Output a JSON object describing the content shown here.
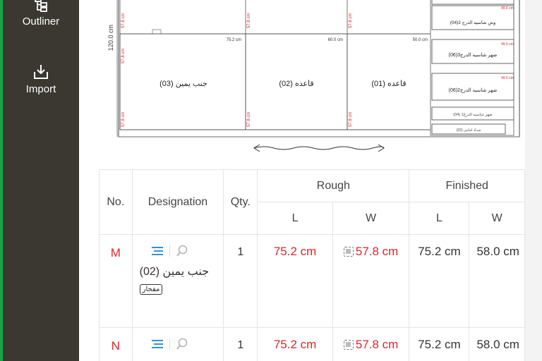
{
  "sidebar": {
    "items": [
      {
        "label": "Outliner",
        "icon": "outliner-icon"
      },
      {
        "label": "Import",
        "icon": "import-icon"
      }
    ]
  },
  "drawing": {
    "height_label": "120.0 cm",
    "widths": [
      "75.2 cm",
      "60.0 cm",
      "50.0 cm"
    ],
    "panels": [
      "جنب يمين (03)",
      "قاعده (02)",
      "قاعده (01)"
    ],
    "panel_edge_label": "57.8 cm",
    "drawers": [
      {
        "size": "49.6 cm",
        "label": "وش شاسيه الدرج 2(04)"
      },
      {
        "size": "49.6 cm",
        "label": "ضهر شاسيه الدرج3(06)"
      },
      {
        "size": "49.6 cm",
        "label": "ضهر شاسيه الدرج2(06)"
      },
      {
        "size": "",
        "label": "ضهر شاسيه الدرج1 (04)"
      },
      {
        "size": "",
        "label": "شداد امامى (03)"
      }
    ],
    "top_drawer_size": "49.6 cm"
  },
  "table": {
    "headers": {
      "no": "No.",
      "designation": "Designation",
      "qty": "Qty.",
      "rough": "Rough",
      "finished": "Finished",
      "l": "L",
      "w": "W"
    },
    "rows": [
      {
        "no": "M",
        "name": "جنب يمين (02)",
        "badge": "مفحار",
        "qty": "1",
        "rough_l": "75.2 cm",
        "rough_w": "57.8 cm",
        "fin_l": "75.2 cm",
        "fin_w": "58.0 cm"
      },
      {
        "no": "N",
        "name": "",
        "badge": "",
        "qty": "1",
        "rough_l": "75.2 cm",
        "rough_w": "57.8 cm",
        "fin_l": "75.2 cm",
        "fin_w": "58.0 cm"
      }
    ]
  }
}
